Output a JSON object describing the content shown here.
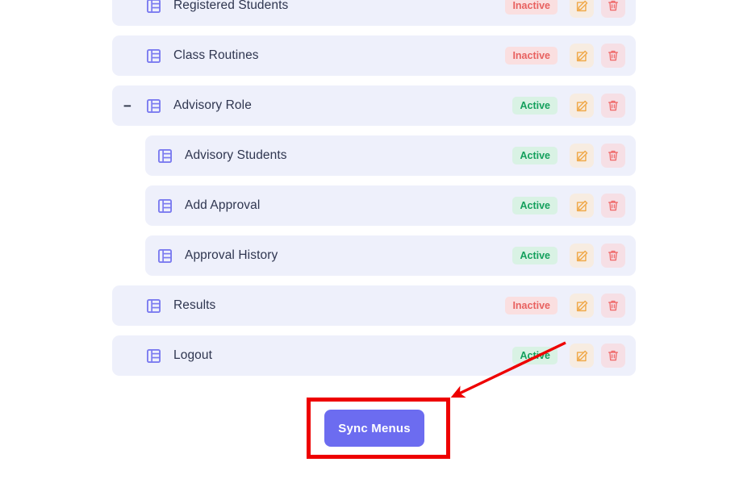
{
  "menu": {
    "rows": [
      {
        "label": "Registered Students",
        "status": "Inactive",
        "state": "inactive",
        "nested": false,
        "toggle": ""
      },
      {
        "label": "Class Routines",
        "status": "Inactive",
        "state": "inactive",
        "nested": false,
        "toggle": ""
      },
      {
        "label": "Advisory Role",
        "status": "Active",
        "state": "active",
        "nested": false,
        "toggle": "−"
      },
      {
        "label": "Advisory Students",
        "status": "Active",
        "state": "active",
        "nested": true,
        "toggle": ""
      },
      {
        "label": "Add Approval",
        "status": "Active",
        "state": "active",
        "nested": true,
        "toggle": ""
      },
      {
        "label": "Approval History",
        "status": "Active",
        "state": "active",
        "nested": true,
        "toggle": ""
      },
      {
        "label": "Results",
        "status": "Inactive",
        "state": "inactive",
        "nested": false,
        "toggle": ""
      },
      {
        "label": "Logout",
        "status": "Active",
        "state": "active",
        "nested": false,
        "toggle": ""
      }
    ],
    "icons": {
      "row": "table-icon",
      "edit": "edit-pencil-icon",
      "delete": "trash-icon",
      "collapse": "collapse-minus-icon"
    }
  },
  "sync": {
    "button_label": "Sync Menus"
  },
  "annotation": {
    "highlight_shape": "rectangle",
    "arrow": "arrow-pointing-to-sync-menus-button"
  },
  "colors": {
    "row_background": "#eef0fb",
    "row_text": "#2f3650",
    "icon_purple": "#7b7bf0",
    "badge_active_text": "#14a05c",
    "badge_active_bg": "#d9f2e4",
    "badge_inactive_text": "#e8615f",
    "badge_inactive_bg": "#fadfe0",
    "edit_bg": "#f7ece1",
    "edit_icon": "#f0a94b",
    "delete_bg": "#f6dfe5",
    "delete_icon": "#ef6b6b",
    "sync_button_bg": "#6c6cf0",
    "annotation_red": "#ee0000",
    "page_background": "#ffffff"
  }
}
